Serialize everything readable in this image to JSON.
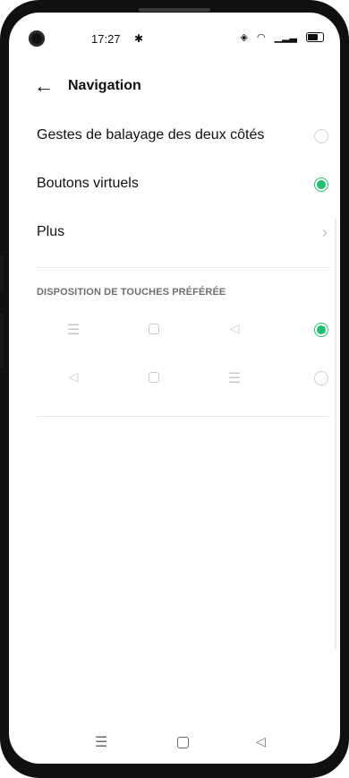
{
  "status_bar": {
    "time": "17:27",
    "settings_icon": "gear-icon",
    "icons": [
      "vibrate-icon",
      "wifi-icon",
      "signal-icon",
      "battery-icon"
    ]
  },
  "header": {
    "title": "Navigation",
    "back_icon": "arrow-left-icon"
  },
  "options": [
    {
      "label": "Gestes de balayage des deux côtés",
      "selected": false
    },
    {
      "label": "Boutons virtuels",
      "selected": true
    },
    {
      "label": "Plus",
      "type": "chevron"
    }
  ],
  "section": {
    "title": "DISPOSITION DE TOUCHES PRÉFÉRÉE"
  },
  "layouts": [
    {
      "keys": [
        "menu-icon",
        "home-icon",
        "back-icon"
      ],
      "selected": true
    },
    {
      "keys": [
        "back-icon",
        "home-icon",
        "menu-icon"
      ],
      "selected": false
    }
  ],
  "nav_bar": {
    "keys": [
      "menu-icon",
      "home-icon",
      "back-icon"
    ]
  },
  "colors": {
    "accent": "#20c06a",
    "text": "#111111",
    "muted": "#6f6f6f"
  }
}
